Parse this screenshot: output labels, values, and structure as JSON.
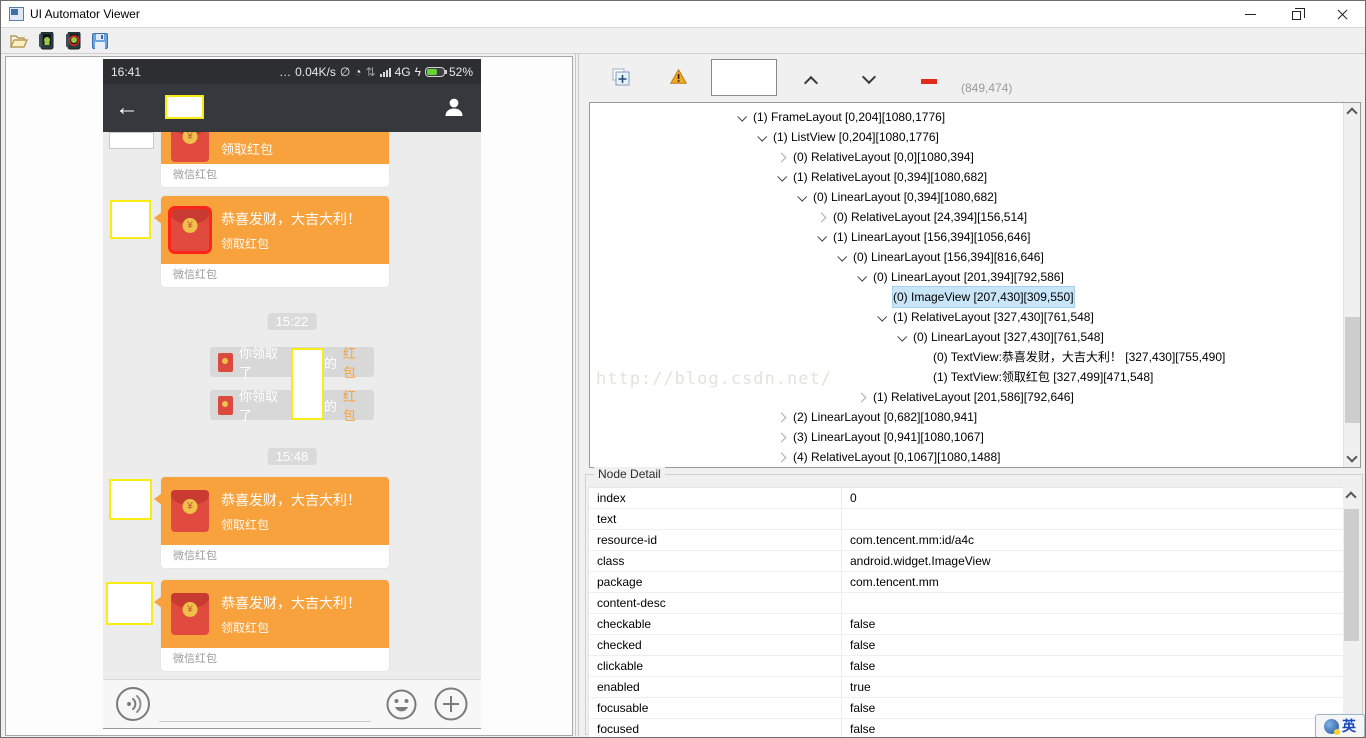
{
  "window": {
    "title": "UI Automator Viewer"
  },
  "phone": {
    "status_bar": {
      "time": "16:41",
      "dots": "…",
      "speed": "0.04K/s",
      "mute_icon": "∅",
      "clock_icon": "◔",
      "vibrate_icon": "⇅",
      "network": "4G",
      "lightning": "ϟ",
      "battery_percent": "52%"
    },
    "title_bar": {
      "back": "←"
    },
    "bubble": {
      "title": "恭喜发财，大吉大利！",
      "action": "领取红包",
      "footer": "微信红包"
    },
    "timestamps": {
      "t1": "15:22",
      "t2": "15:48"
    },
    "notification": {
      "prefix": "你领取了",
      "particle": "的",
      "highlight": "红包"
    }
  },
  "tree": {
    "coords": "(849,474)",
    "watermark": "http://blog.csdn.net/",
    "nodes": [
      {
        "label": "(1) FrameLayout [0,204][1080,1776]",
        "indent": 148,
        "state": "expanded",
        "selected": false
      },
      {
        "label": "(1) ListView [0,204][1080,1776]",
        "indent": 168,
        "state": "expanded",
        "selected": false
      },
      {
        "label": "(0) RelativeLayout [0,0][1080,394]",
        "indent": 188,
        "state": "collapsed",
        "selected": false
      },
      {
        "label": "(1) RelativeLayout [0,394][1080,682]",
        "indent": 188,
        "state": "expanded",
        "selected": false
      },
      {
        "label": "(0) LinearLayout [0,394][1080,682]",
        "indent": 208,
        "state": "expanded",
        "selected": false
      },
      {
        "label": "(0) RelativeLayout [24,394][156,514]",
        "indent": 228,
        "state": "collapsed",
        "selected": false
      },
      {
        "label": "(1) LinearLayout [156,394][1056,646]",
        "indent": 228,
        "state": "expanded",
        "selected": false
      },
      {
        "label": "(0) LinearLayout [156,394][816,646]",
        "indent": 248,
        "state": "expanded",
        "selected": false
      },
      {
        "label": "(0) LinearLayout [201,394][792,586]",
        "indent": 268,
        "state": "expanded",
        "selected": false
      },
      {
        "label": "(0) ImageView [207,430][309,550]",
        "indent": 288,
        "state": "leaf",
        "selected": true
      },
      {
        "label": "(1) RelativeLayout [327,430][761,548]",
        "indent": 288,
        "state": "expanded",
        "selected": false
      },
      {
        "label": "(0) LinearLayout [327,430][761,548]",
        "indent": 308,
        "state": "expanded",
        "selected": false
      },
      {
        "label": "(0) TextView:恭喜发财，大吉大利！ [327,430][755,490]",
        "indent": 328,
        "state": "leaf",
        "selected": false
      },
      {
        "label": "(1) TextView:领取红包 [327,499][471,548]",
        "indent": 328,
        "state": "leaf",
        "selected": false
      },
      {
        "label": "(1) RelativeLayout [201,586][792,646]",
        "indent": 268,
        "state": "collapsed",
        "selected": false
      },
      {
        "label": "(2) LinearLayout [0,682][1080,941]",
        "indent": 188,
        "state": "collapsed",
        "selected": false
      },
      {
        "label": "(3) LinearLayout [0,941][1080,1067]",
        "indent": 188,
        "state": "collapsed",
        "selected": false
      },
      {
        "label": "(4) RelativeLayout [0,1067][1080,1488]",
        "indent": 188,
        "state": "collapsed",
        "selected": false
      }
    ]
  },
  "node_detail": {
    "title": "Node Detail",
    "rows": [
      [
        "index",
        "0"
      ],
      [
        "text",
        ""
      ],
      [
        "resource-id",
        "com.tencent.mm:id/a4c"
      ],
      [
        "class",
        "android.widget.ImageView"
      ],
      [
        "package",
        "com.tencent.mm"
      ],
      [
        "content-desc",
        ""
      ],
      [
        "checkable",
        "false"
      ],
      [
        "checked",
        "false"
      ],
      [
        "clickable",
        "false"
      ],
      [
        "enabled",
        "true"
      ],
      [
        "focusable",
        "false"
      ],
      [
        "focused",
        "false"
      ]
    ]
  },
  "ime": {
    "lang": "英"
  },
  "colors": {
    "accent_orange": "#f7a23d",
    "packet_red": "#e14b3f",
    "selection_blue": "#c9e6f8",
    "highlight_yellow": "#f7ec13",
    "wechat_dark": "#35383d"
  }
}
